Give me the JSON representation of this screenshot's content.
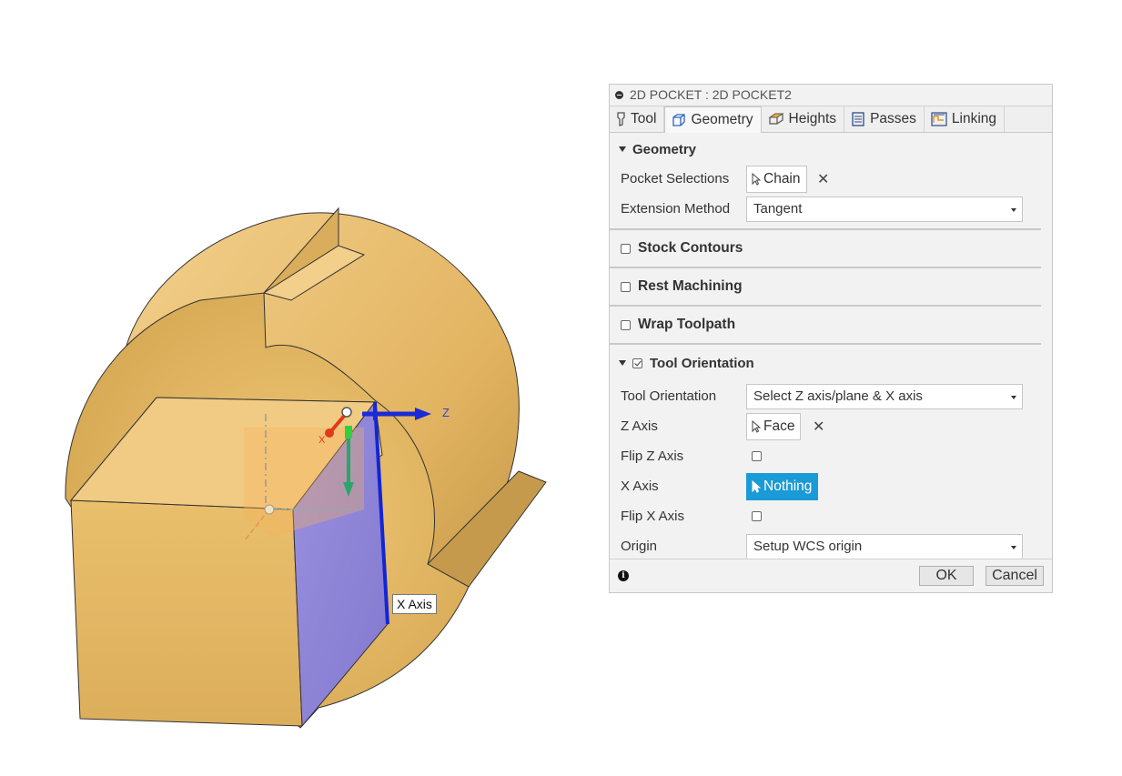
{
  "viewport": {
    "x_axis_label": "X Axis",
    "z_label": "Z",
    "x_small_label": "X"
  },
  "panel": {
    "title": "2D POCKET : 2D POCKET2",
    "tabs": [
      {
        "label": "Tool",
        "icon": "tool-icon",
        "active": false
      },
      {
        "label": "Geometry",
        "icon": "geometry-cube-icon",
        "active": true
      },
      {
        "label": "Heights",
        "icon": "heights-icon",
        "active": false
      },
      {
        "label": "Passes",
        "icon": "passes-icon",
        "active": false
      },
      {
        "label": "Linking",
        "icon": "linking-icon",
        "active": false
      }
    ],
    "geometry": {
      "heading": "Geometry",
      "pocket_selections_label": "Pocket Selections",
      "pocket_selections_value": "Chain",
      "extension_method_label": "Extension Method",
      "extension_method_value": "Tangent"
    },
    "stock_contours": {
      "label": "Stock Contours",
      "checked": false
    },
    "rest_machining": {
      "label": "Rest Machining",
      "checked": false
    },
    "wrap_toolpath": {
      "label": "Wrap Toolpath",
      "checked": false
    },
    "tool_orientation": {
      "heading": "Tool Orientation",
      "checked": true,
      "orientation_label": "Tool Orientation",
      "orientation_value": "Select Z axis/plane & X axis",
      "z_axis_label": "Z Axis",
      "z_axis_value": "Face",
      "flip_z_label": "Flip Z Axis",
      "flip_z_checked": false,
      "x_axis_label": "X Axis",
      "x_axis_value": "Nothing",
      "flip_x_label": "Flip X Axis",
      "flip_x_checked": false,
      "origin_label": "Origin",
      "origin_value": "Setup WCS origin"
    },
    "footer": {
      "ok_label": "OK",
      "cancel_label": "Cancel"
    }
  },
  "colors": {
    "part": "#e8bf6e",
    "selected_face": "#8f86d6",
    "accent": "#1a9ad6"
  }
}
